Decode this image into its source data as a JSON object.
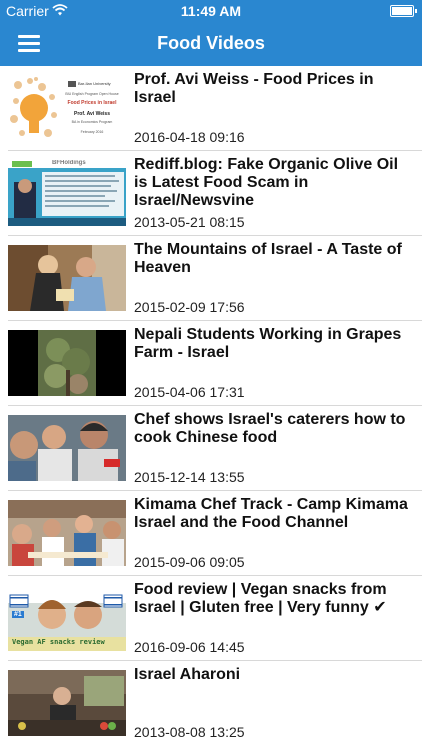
{
  "status_bar": {
    "carrier": "Carrier",
    "time": "11:49 AM"
  },
  "navbar": {
    "title": "Food Videos"
  },
  "videos": [
    {
      "title": "Prof. Avi Weiss - Food Prices in Israel",
      "date": "2016-04-18 09:16",
      "thumb_text": {
        "org": "Bar-Ilan University",
        "program": "BIU English Program Open House",
        "talk": "Food Prices in Israel",
        "speaker": "Prof. Avi Weiss",
        "role": "BA in Economics Program",
        "when": "February 2016"
      }
    },
    {
      "title": "Rediff.blog: Fake Organic Olive Oil is Latest Food Scam in Israel/Newsvine",
      "date": "2013-05-21 08:15",
      "thumb_text": {
        "banner": "BFHoldings"
      }
    },
    {
      "title": "The Mountains of Israel -  A Taste of Heaven",
      "date": "2015-02-09 17:56"
    },
    {
      "title": "Nepali Students Working in Grapes Farm - Israel",
      "date": "2015-04-06 17:31"
    },
    {
      "title": "Chef shows Israel's caterers how to cook Chinese food",
      "date": "2015-12-14 13:55"
    },
    {
      "title": "Kimama Chef Track - Camp Kimama Israel and the Food Channel",
      "date": "2015-09-06 09:05"
    },
    {
      "title": "Food review | Vegan snacks from Israel | Gluten free | Very funny ✔",
      "date": "2016-09-06 14:45",
      "thumb_text": {
        "caption": "Vegan AF snacks review",
        "badge": "#1"
      }
    },
    {
      "title": "Israel Aharoni",
      "date": "2013-08-08 13:25"
    }
  ]
}
